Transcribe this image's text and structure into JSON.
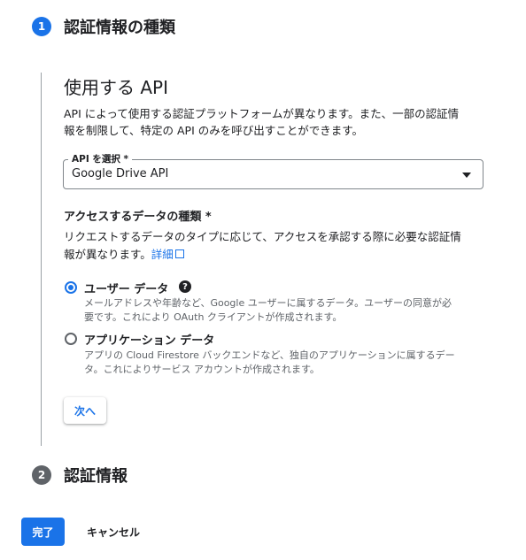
{
  "step1": {
    "number": "1",
    "title": "認証情報の種類",
    "color": "#1a73e8"
  },
  "section": {
    "title": "使用する API",
    "desc_line1": "API によって使用する認証プラットフォームが異なります。また、一部の認証情",
    "desc_line2": "報を制限して、特定の API のみを呼び出すことができます。"
  },
  "api_select": {
    "label": "API を選択 *",
    "value": "Google Drive API"
  },
  "data_type": {
    "heading": "アクセスするデータの種類 *",
    "desc_line1": "リクエストするデータのタイプに応じて、アクセスを承認する際に必要な認証情",
    "desc_line2": "報が異なります。",
    "link": "詳細"
  },
  "options": [
    {
      "label": "ユーザー データ",
      "selected": true,
      "help": "?",
      "desc_line1": "メールアドレスや年齢など、Google ユーザーに属するデータ。ユーザーの同意が必",
      "desc_line2": "要です。これにより OAuth クライアントが作成されます。"
    },
    {
      "label": "アプリケーション データ",
      "selected": false,
      "desc_line1": "アプリの Cloud Firestore バックエンドなど、独自のアプリケーションに属するデー",
      "desc_line2": "タ。これによりサービス アカウントが作成されます。"
    }
  ],
  "next_button": "次へ",
  "step2": {
    "number": "2",
    "title": "認証情報",
    "color": "#5f6368"
  },
  "footer": {
    "done": "完了",
    "cancel": "キャンセル"
  },
  "colors": {
    "accent": "#1a73e8",
    "text": "#202124",
    "muted": "#5f6368"
  }
}
